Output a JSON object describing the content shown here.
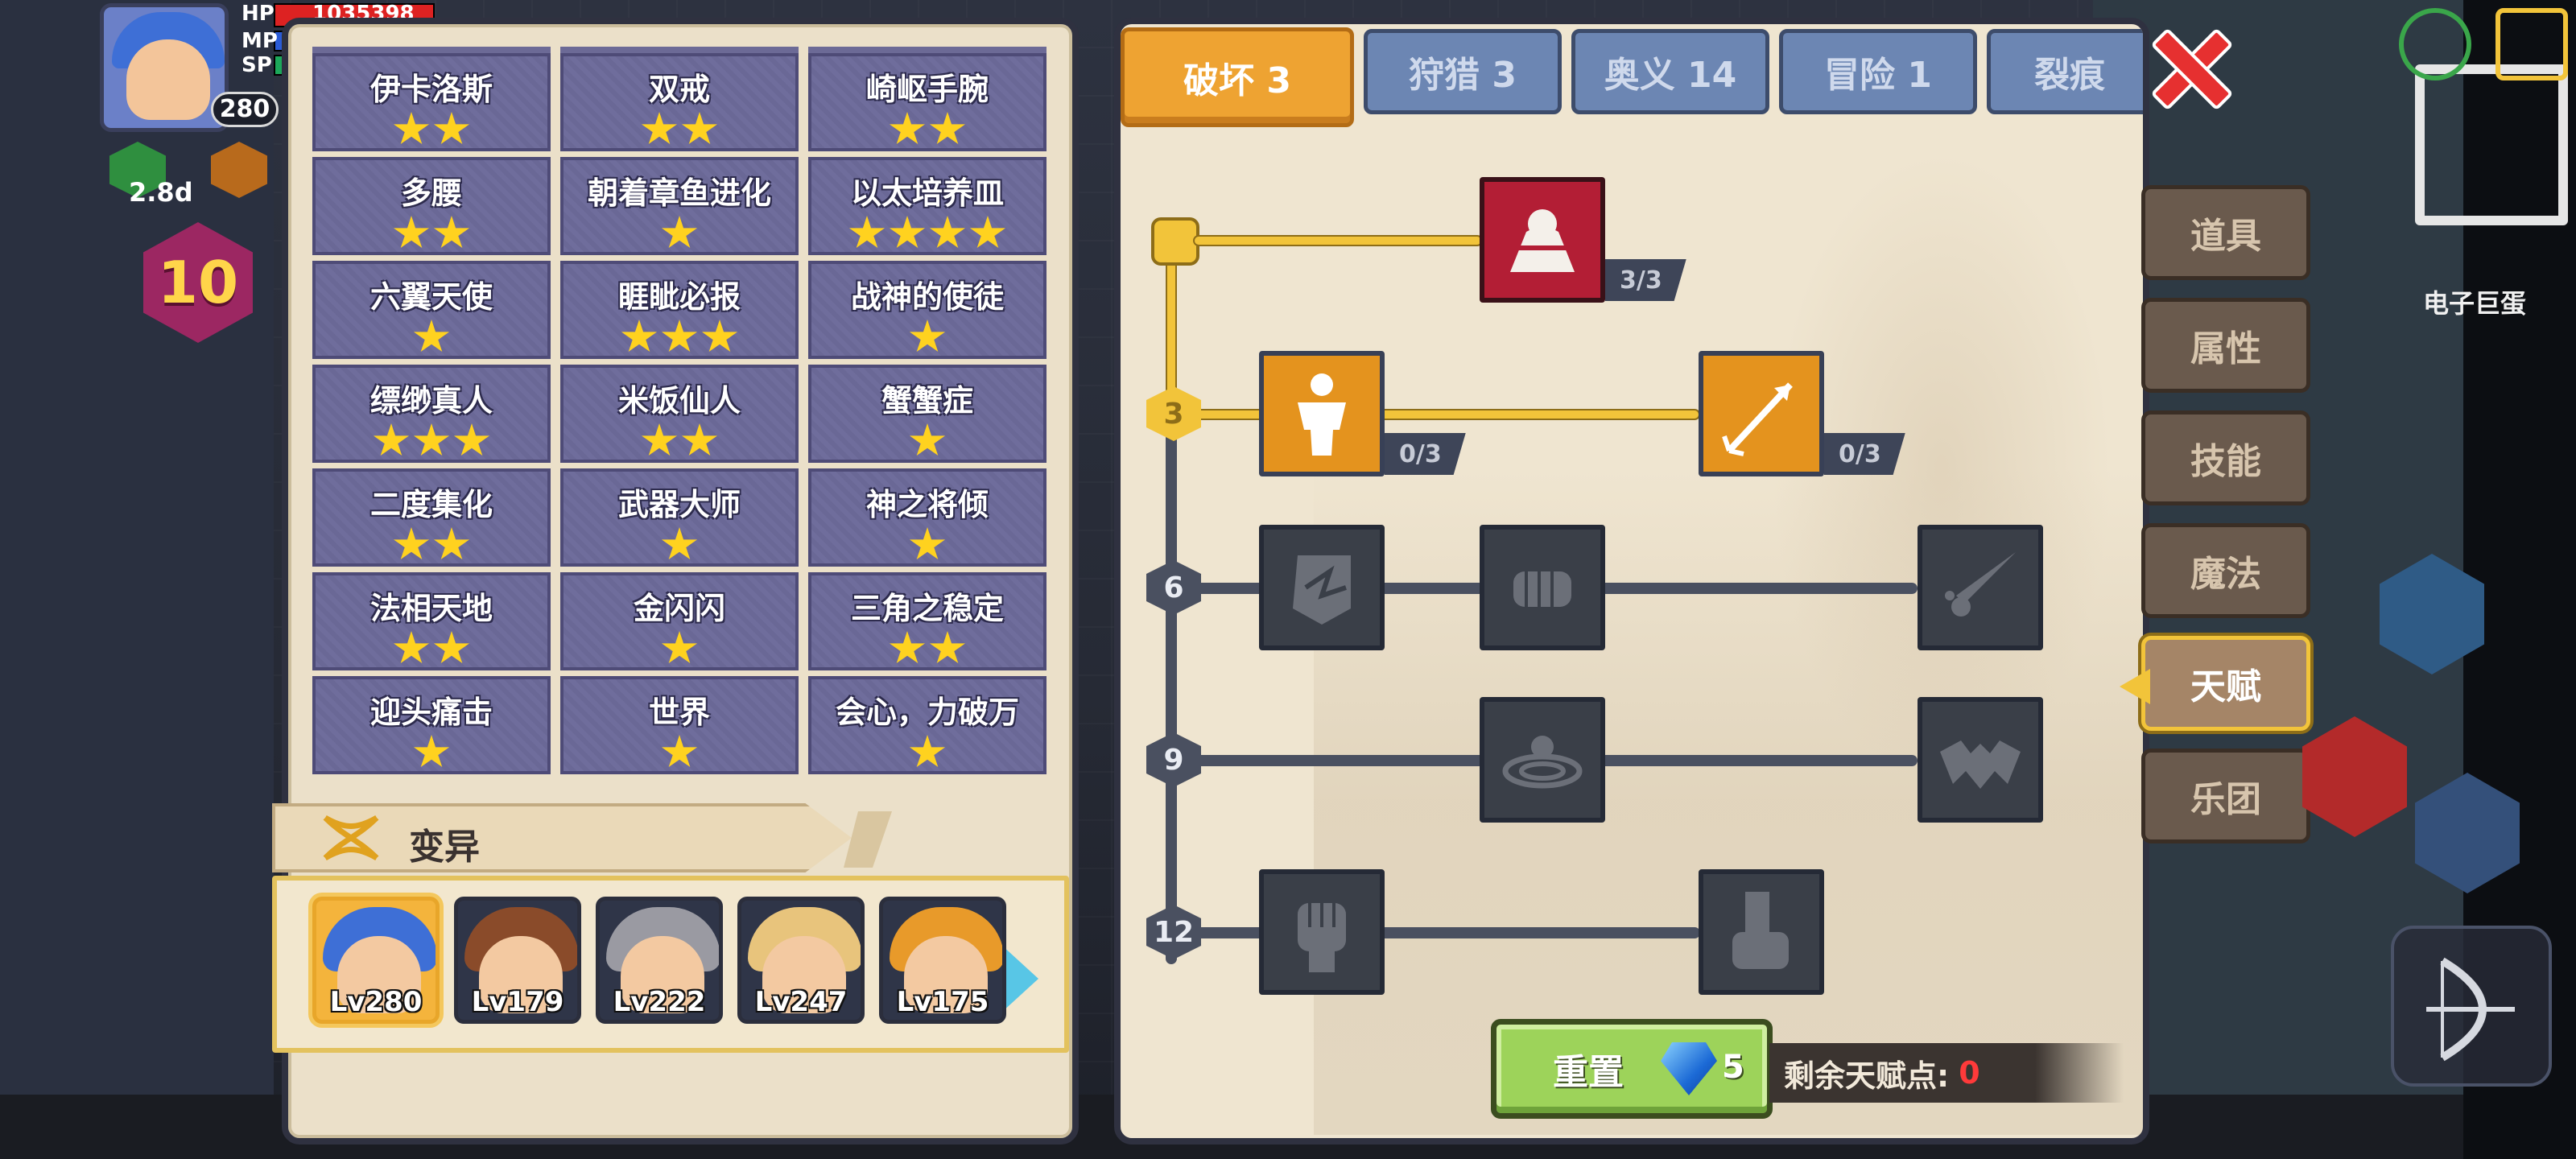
{
  "hud": {
    "hp_label": "HP",
    "mp_label": "MP",
    "sp_label": "SP",
    "hp_value": "1035398",
    "level": "280",
    "timer": "2.8d",
    "floor": "10"
  },
  "mutations": {
    "section_title": "变异",
    "items": [
      {
        "name": "伊卡洛斯",
        "stars": 2
      },
      {
        "name": "双戒",
        "stars": 2
      },
      {
        "name": "崎岖手腕",
        "stars": 2
      },
      {
        "name": "多腰",
        "stars": 2
      },
      {
        "name": "朝着章鱼进化",
        "stars": 1
      },
      {
        "name": "以太培养皿",
        "stars": 4
      },
      {
        "name": "六翼天使",
        "stars": 1
      },
      {
        "name": "睚眦必报",
        "stars": 3
      },
      {
        "name": "战神的使徒",
        "stars": 1
      },
      {
        "name": "缥缈真人",
        "stars": 3
      },
      {
        "name": "米饭仙人",
        "stars": 2
      },
      {
        "name": "蟹蟹症",
        "stars": 1
      },
      {
        "name": "二度集化",
        "stars": 2
      },
      {
        "name": "武器大师",
        "stars": 1
      },
      {
        "name": "神之将倾",
        "stars": 1
      },
      {
        "name": "法相天地",
        "stars": 2
      },
      {
        "name": "金闪闪",
        "stars": 1
      },
      {
        "name": "三角之稳定",
        "stars": 2
      },
      {
        "name": "迎头痛击",
        "stars": 1
      },
      {
        "name": "世界",
        "stars": 1
      },
      {
        "name": "会心，力破万",
        "stars": 1
      }
    ]
  },
  "characters": [
    {
      "level": "Lv280",
      "selected": true,
      "hair": "#3e6fd6"
    },
    {
      "level": "Lv179",
      "selected": false,
      "hair": "#8a4b2a"
    },
    {
      "level": "Lv222",
      "selected": false,
      "hair": "#9a9aa2"
    },
    {
      "level": "Lv247",
      "selected": false,
      "hair": "#e8c47c"
    },
    {
      "level": "Lv175",
      "selected": false,
      "hair": "#e89a2a"
    }
  ],
  "tabs": [
    {
      "label": "破坏 3",
      "active": true
    },
    {
      "label": "狩猎 3",
      "active": false
    },
    {
      "label": "奥义 14",
      "active": false
    },
    {
      "label": "冒险 1",
      "active": false
    },
    {
      "label": "裂痕",
      "active": false
    }
  ],
  "talent_tree": {
    "tiers": [
      "3",
      "6",
      "9",
      "12"
    ],
    "talents": [
      {
        "icon": "arm-wrestle-icon",
        "count": "3/3",
        "state": "red"
      },
      {
        "icon": "body-icon",
        "count": "0/3",
        "state": "orange"
      },
      {
        "icon": "arrow-icon",
        "count": "0/3",
        "state": "orange"
      },
      {
        "icon": "shield-break-icon",
        "state": "locked"
      },
      {
        "icon": "fist-punch-icon",
        "state": "locked"
      },
      {
        "icon": "blade-splash-icon",
        "state": "locked"
      },
      {
        "icon": "ripple-icon",
        "state": "locked"
      },
      {
        "icon": "bat-icon",
        "state": "locked"
      },
      {
        "icon": "raised-fist-icon",
        "state": "locked"
      },
      {
        "icon": "grip-icon",
        "state": "locked"
      }
    ]
  },
  "reset": {
    "label": "重置",
    "cost": "5"
  },
  "remaining_points": {
    "label": "剩余天赋点:",
    "value": "0"
  },
  "side_menu": [
    {
      "label": "道具",
      "active": false
    },
    {
      "label": "属性",
      "active": false
    },
    {
      "label": "技能",
      "active": false
    },
    {
      "label": "魔法",
      "active": false
    },
    {
      "label": "天赋",
      "active": true
    },
    {
      "label": "乐团",
      "active": false
    }
  ],
  "world": {
    "npc_label": "电子巨蛋"
  }
}
